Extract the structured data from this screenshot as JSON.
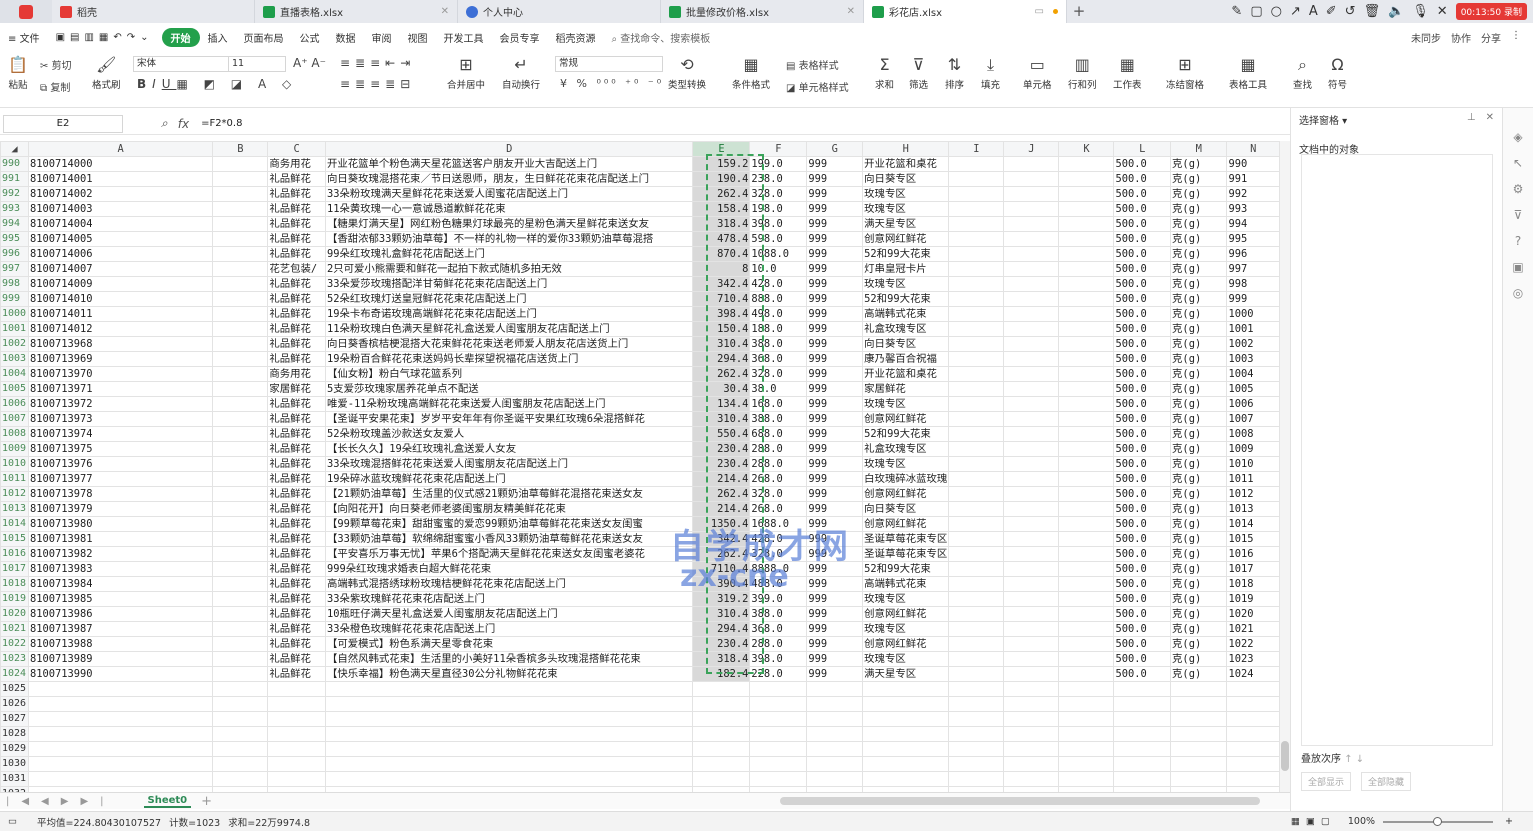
{
  "tabs": [
    {
      "label": "稻壳",
      "color": "#e53935"
    },
    {
      "label": "直播表格.xlsx",
      "color": "#1e9e4b"
    },
    {
      "label": "个人中心",
      "color": "#3d6fd6"
    },
    {
      "label": "批量修改价格.xlsx",
      "color": "#1e9e4b"
    },
    {
      "label": "彩花店.xlsx",
      "color": "#1e9e4b"
    }
  ],
  "timer": "00:13:50 录制",
  "menu": {
    "file": "文件",
    "items": [
      "开始",
      "插入",
      "页面布局",
      "公式",
      "数据",
      "审阅",
      "视图",
      "开发工具",
      "会员专享",
      "稻壳资源"
    ],
    "search": "查找命令、搜索模板",
    "right": [
      "未同步",
      "协作",
      "分享"
    ]
  },
  "ribbon": {
    "paste": "粘贴",
    "cut": "剪切",
    "copy": "复制",
    "format_painter": "格式刷",
    "font": "宋体",
    "size": "11",
    "numfmt": "常规",
    "merge": "合并居中",
    "wrap": "自动换行",
    "type_convert": "类型转换",
    "cond": "条件格式",
    "table_style": "表格样式",
    "cell_style": "单元格样式",
    "sum": "求和",
    "filter": "筛选",
    "sort": "排序",
    "fill": "填充",
    "cell": "单元格",
    "rowcol": "行和列",
    "sheet": "工作表",
    "freeze": "冻结窗格",
    "tools": "表格工具",
    "find": "查找",
    "symbol": "符号"
  },
  "formula_bar": {
    "cell": "E2",
    "formula": "=F2*0.8"
  },
  "columns": [
    "A",
    "B",
    "C",
    "D",
    "E",
    "F",
    "G",
    "H",
    "I",
    "J",
    "K",
    "L",
    "M",
    "N"
  ],
  "rows": [
    {
      "n": "990",
      "a": "8100714000",
      "c": "商务用花",
      "d": "开业花篮单个粉色满天星花篮送客户朋友开业大吉配送上门",
      "e": "159.2",
      "f": "199.0",
      "g": "999",
      "h": "开业花篮和桌花",
      "l": "500.0",
      "m": "克(g)"
    },
    {
      "n": "991",
      "a": "8100714001",
      "c": "礼品鲜花",
      "d": "向日葵玫瑰混搭花束／节日送恩师，朋友，生日鲜花花束花店配送上门",
      "e": "190.4",
      "f": "238.0",
      "g": "999",
      "h": "向日葵专区",
      "l": "500.0",
      "m": "克(g)"
    },
    {
      "n": "992",
      "a": "8100714002",
      "c": "礼品鲜花",
      "d": "33朵粉玫瑰满天星鲜花花束送爱人闺蜜花店配送上门",
      "e": "262.4",
      "f": "328.0",
      "g": "999",
      "h": "玫瑰专区",
      "l": "500.0",
      "m": "克(g)"
    },
    {
      "n": "993",
      "a": "8100714003",
      "c": "礼品鲜花",
      "d": "11朵黄玫瑰一心一意诚恳道歉鲜花花束",
      "e": "158.4",
      "f": "198.0",
      "g": "999",
      "h": "玫瑰专区",
      "l": "500.0",
      "m": "克(g)"
    },
    {
      "n": "994",
      "a": "8100714004",
      "c": "礼品鲜花",
      "d": "【糖果灯满天星】网红粉色糖果灯球最亮的星粉色满天星鲜花束送女友",
      "e": "318.4",
      "f": "398.0",
      "g": "999",
      "h": "满天星专区",
      "l": "500.0",
      "m": "克(g)"
    },
    {
      "n": "995",
      "a": "8100714005",
      "c": "礼品鲜花",
      "d": "【香甜浓郁33颗奶油草莓】不一样的礼物一样的爱你33颗奶油草莓混搭",
      "e": "478.4",
      "f": "598.0",
      "g": "999",
      "h": "创意网红鲜花",
      "l": "500.0",
      "m": "克(g)"
    },
    {
      "n": "996",
      "a": "8100714006",
      "c": "礼品鲜花",
      "d": "99朵红玫瑰礼盒鲜花花店配送上门",
      "e": "870.4",
      "f": "1088.0",
      "g": "999",
      "h": "52和99大花束",
      "l": "500.0",
      "m": "克(g)"
    },
    {
      "n": "997",
      "a": "8100714007",
      "c": "花艺包装/",
      "d": "2只可爱小熊需要和鲜花一起拍下款式随机多拍无效",
      "e": "8",
      "f": "10.0",
      "g": "999",
      "h": "灯串皇冠卡片",
      "l": "500.0",
      "m": "克(g)"
    },
    {
      "n": "998",
      "a": "8100714009",
      "c": "礼品鲜花",
      "d": "33朵爱莎玫瑰搭配洋甘菊鲜花花束花店配送上门",
      "e": "342.4",
      "f": "428.0",
      "g": "999",
      "h": "玫瑰专区",
      "l": "500.0",
      "m": "克(g)"
    },
    {
      "n": "999",
      "a": "8100714010",
      "c": "礼品鲜花",
      "d": "52朵红玫瑰灯送皇冠鲜花花束花店配送上门",
      "e": "710.4",
      "f": "888.0",
      "g": "999",
      "h": "52和99大花束",
      "l": "500.0",
      "m": "克(g)"
    },
    {
      "n": "1000",
      "a": "8100714011",
      "c": "礼品鲜花",
      "d": "19朵卡布奇诺玫瑰高端鲜花花束花店配送上门",
      "e": "398.4",
      "f": "498.0",
      "g": "999",
      "h": "高端韩式花束",
      "l": "500.0",
      "m": "克(g)"
    },
    {
      "n": "1001",
      "a": "8100714012",
      "c": "礼品鲜花",
      "d": "11朵粉玫瑰白色满天星鲜花礼盒送爱人闺蜜朋友花店配送上门",
      "e": "150.4",
      "f": "188.0",
      "g": "999",
      "h": "礼盒玫瑰专区",
      "l": "500.0",
      "m": "克(g)"
    },
    {
      "n": "1002",
      "a": "8100713968",
      "c": "礼品鲜花",
      "d": "向日葵香槟桔梗混搭大花束鲜花花束送老师爱人朋友花店送货上门",
      "e": "310.4",
      "f": "388.0",
      "g": "999",
      "h": "向日葵专区",
      "l": "500.0",
      "m": "克(g)"
    },
    {
      "n": "1003",
      "a": "8100713969",
      "c": "礼品鲜花",
      "d": "19朵粉百合鲜花花束送妈妈长辈探望祝福花店送货上门",
      "e": "294.4",
      "f": "368.0",
      "g": "999",
      "h": "康乃馨百合祝福",
      "l": "500.0",
      "m": "克(g)"
    },
    {
      "n": "1004",
      "a": "8100713970",
      "c": "商务用花",
      "d": "【仙女粉】粉白气球花篮系列",
      "e": "262.4",
      "f": "328.0",
      "g": "999",
      "h": "开业花篮和桌花",
      "l": "500.0",
      "m": "克(g)"
    },
    {
      "n": "1005",
      "a": "8100713971",
      "c": "家居鲜花",
      "d": "5支爱莎玫瑰家居养花单点不配送",
      "e": "30.4",
      "f": "38.0",
      "g": "999",
      "h": "家居鲜花",
      "l": "500.0",
      "m": "克(g)"
    },
    {
      "n": "1006",
      "a": "8100713972",
      "c": "礼品鲜花",
      "d": "唯爱-11朵粉玫瑰高端鲜花花束送爱人闺蜜朋友花店配送上门",
      "e": "134.4",
      "f": "168.0",
      "g": "999",
      "h": "玫瑰专区",
      "l": "500.0",
      "m": "克(g)"
    },
    {
      "n": "1007",
      "a": "8100713973",
      "c": "礼品鲜花",
      "d": "【圣诞平安果花束】岁岁平安年年有你圣诞平安果红玫瑰6朵混搭鲜花",
      "e": "310.4",
      "f": "388.0",
      "g": "999",
      "h": "创意网红鲜花",
      "l": "500.0",
      "m": "克(g)"
    },
    {
      "n": "1008",
      "a": "8100713974",
      "c": "礼品鲜花",
      "d": "52朵粉玫瑰盖沙款送女友爱人",
      "e": "550.4",
      "f": "688.0",
      "g": "999",
      "h": "52和99大花束",
      "l": "500.0",
      "m": "克(g)"
    },
    {
      "n": "1009",
      "a": "8100713975",
      "c": "礼品鲜花",
      "d": "【长长久久】19朵红玫瑰礼盒送爱人女友",
      "e": "230.4",
      "f": "288.0",
      "g": "999",
      "h": "礼盒玫瑰专区",
      "l": "500.0",
      "m": "克(g)"
    },
    {
      "n": "1010",
      "a": "8100713976",
      "c": "礼品鲜花",
      "d": "33朵玫瑰混搭鲜花花束送爱人闺蜜朋友花店配送上门",
      "e": "230.4",
      "f": "288.0",
      "g": "999",
      "h": "玫瑰专区",
      "l": "500.0",
      "m": "克(g)"
    },
    {
      "n": "1011",
      "a": "8100713977",
      "c": "礼品鲜花",
      "d": "19朵碎冰蓝玫瑰鲜花花束花店配送上门",
      "e": "214.4",
      "f": "268.0",
      "g": "999",
      "h": "白玫瑰碎冰蓝玫瑰",
      "l": "500.0",
      "m": "克(g)"
    },
    {
      "n": "1012",
      "a": "8100713978",
      "c": "礼品鲜花",
      "d": "【21颗奶油草莓】生活里的仪式感21颗奶油草莓鲜花混搭花束送女友",
      "e": "262.4",
      "f": "328.0",
      "g": "999",
      "h": "创意网红鲜花",
      "l": "500.0",
      "m": "克(g)"
    },
    {
      "n": "1013",
      "a": "8100713979",
      "c": "礼品鲜花",
      "d": "【向阳花开】向日葵老师老婆闺蜜朋友精美鲜花花束",
      "e": "214.4",
      "f": "268.0",
      "g": "999",
      "h": "向日葵专区",
      "l": "500.0",
      "m": "克(g)"
    },
    {
      "n": "1014",
      "a": "8100713980",
      "c": "礼品鲜花",
      "d": "【99颗草莓花束】甜甜蜜蜜的爱恋99颗奶油草莓鲜花花束送女友闺蜜",
      "e": "1350.4",
      "f": "1688.0",
      "g": "999",
      "h": "创意网红鲜花",
      "l": "500.0",
      "m": "克(g)"
    },
    {
      "n": "1015",
      "a": "8100713981",
      "c": "礼品鲜花",
      "d": "【33颗奶油草莓】软绵绵甜蜜蜜小香风33颗奶油草莓鲜花花束送女友",
      "e": "342.4",
      "f": "428.0",
      "g": "999",
      "h": "圣诞草莓花束专区",
      "l": "500.0",
      "m": "克(g)"
    },
    {
      "n": "1016",
      "a": "8100713982",
      "c": "礼品鲜花",
      "d": "【平安喜乐万事无忧】苹果6个搭配满天星鲜花花束送女友闺蜜老婆花",
      "e": "262.4",
      "f": "328.0",
      "g": "999",
      "h": "圣诞草莓花束专区",
      "l": "500.0",
      "m": "克(g)"
    },
    {
      "n": "1017",
      "a": "8100713983",
      "c": "礼品鲜花",
      "d": "999朵红玫瑰求婚表白超大鲜花花束",
      "e": "7110.4",
      "f": "8888.0",
      "g": "999",
      "h": "52和99大花束",
      "l": "500.0",
      "m": "克(g)"
    },
    {
      "n": "1018",
      "a": "8100713984",
      "c": "礼品鲜花",
      "d": "高端韩式混搭绣球粉玫瑰桔梗鲜花花束花店配送上门",
      "e": "390.4",
      "f": "488.0",
      "g": "999",
      "h": "高端韩式花束",
      "l": "500.0",
      "m": "克(g)"
    },
    {
      "n": "1019",
      "a": "8100713985",
      "c": "礼品鲜花",
      "d": "33朵紫玫瑰鲜花花束花店配送上门",
      "e": "319.2",
      "f": "399.0",
      "g": "999",
      "h": "玫瑰专区",
      "l": "500.0",
      "m": "克(g)"
    },
    {
      "n": "1020",
      "a": "8100713986",
      "c": "礼品鲜花",
      "d": "10瓶旺仔满天星礼盒送爱人闺蜜朋友花店配送上门",
      "e": "310.4",
      "f": "388.0",
      "g": "999",
      "h": "创意网红鲜花",
      "l": "500.0",
      "m": "克(g)"
    },
    {
      "n": "1021",
      "a": "8100713987",
      "c": "礼品鲜花",
      "d": "33朵橙色玫瑰鲜花花束花店配送上门",
      "e": "294.4",
      "f": "368.0",
      "g": "999",
      "h": "玫瑰专区",
      "l": "500.0",
      "m": "克(g)"
    },
    {
      "n": "1022",
      "a": "8100713988",
      "c": "礼品鲜花",
      "d": "【可爱模式】粉色系满天星零食花束",
      "e": "230.4",
      "f": "288.0",
      "g": "999",
      "h": "创意网红鲜花",
      "l": "500.0",
      "m": "克(g)"
    },
    {
      "n": "1023",
      "a": "8100713989",
      "c": "礼品鲜花",
      "d": "【自然风韩式花束】生活里的小美好11朵香槟多头玫瑰混搭鲜花花束",
      "e": "318.4",
      "f": "398.0",
      "g": "999",
      "h": "玫瑰专区",
      "l": "500.0",
      "m": "克(g)"
    },
    {
      "n": "1024",
      "a": "8100713990",
      "c": "礼品鲜花",
      "d": "【快乐幸福】粉色满天星直径30公分礼物鲜花花束",
      "e": "182.4",
      "f": "228.0",
      "g": "999",
      "h": "满天星专区",
      "l": "500.0",
      "m": "克(g)"
    }
  ],
  "empty_rows": [
    "1025",
    "1026",
    "1027",
    "1028",
    "1029",
    "1030",
    "1031",
    "1032",
    "1033"
  ],
  "sheet": "Sheet0",
  "status": {
    "avg": "平均值=224.80430107527",
    "count": "计数=1023",
    "sum": "求和=22万9974.8",
    "zoom": "100%"
  },
  "panel": {
    "title": "选择窗格",
    "subtitle": "文档中的对象",
    "order": "叠放次序",
    "show_all": "全部显示",
    "hide_all": "全部隐藏"
  },
  "watermark": {
    "line1": "自学成才网",
    "line2": "zx-cne"
  }
}
